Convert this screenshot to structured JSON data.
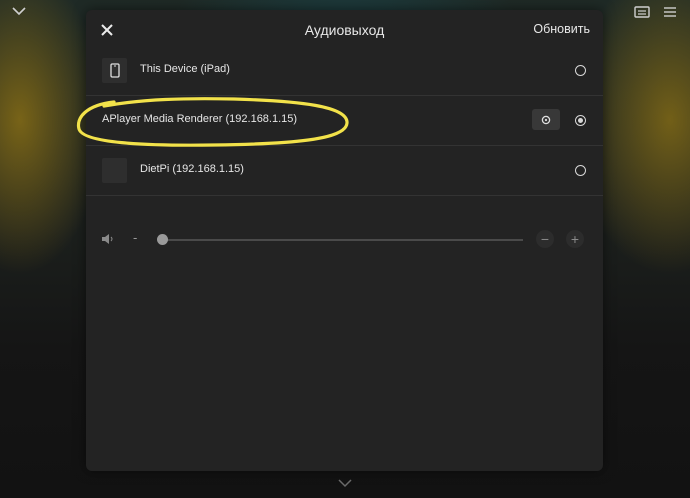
{
  "header": {
    "title": "Аудиовыход",
    "refresh_label": "Обновить",
    "close_icon": "close-icon"
  },
  "devices": [
    {
      "name": "This Device (iPad)",
      "icon": "tablet-icon",
      "selected": false
    },
    {
      "name": "APlayer Media Renderer (192.168.1.15)",
      "icon": "",
      "selected": true,
      "has_settings": true
    },
    {
      "name": "DietPi (192.168.1.15)",
      "icon": "",
      "selected": false
    }
  ],
  "volume": {
    "minus_label": "-",
    "decrease_label": "−",
    "increase_label": "+",
    "level": 0
  },
  "colors": {
    "modal_bg": "#232323",
    "annotation": "#f2e24a",
    "text": "#e6e6e6"
  }
}
